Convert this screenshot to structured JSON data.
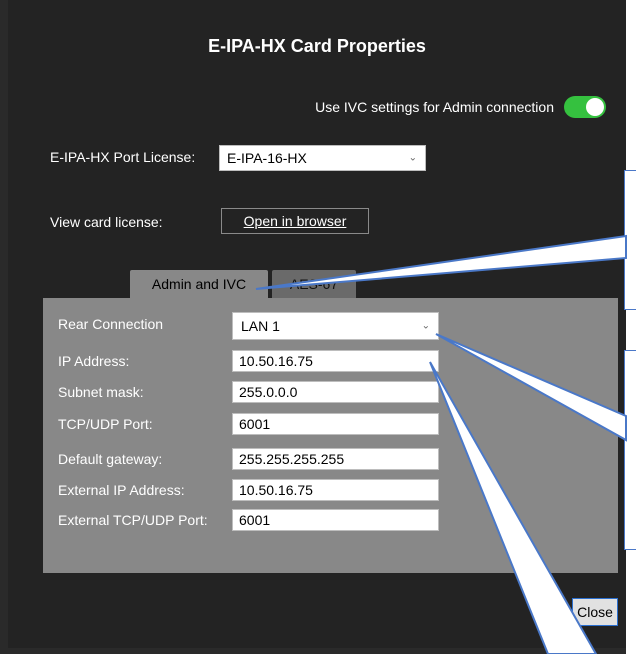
{
  "window": {
    "title": "E-IPA-HX Card Properties"
  },
  "admin_toggle": {
    "label": "Use IVC settings for Admin connection",
    "state": "on",
    "color": "#35c13f"
  },
  "port_license": {
    "label": "E-IPA-HX Port License:",
    "selected": "E-IPA-16-HX"
  },
  "card_license": {
    "label": "View card license:",
    "button_label": "Open in browser"
  },
  "tabs": [
    {
      "label": "Admin and IVC",
      "active": true
    },
    {
      "label": "AES-67",
      "active": false
    }
  ],
  "settings": {
    "rear_connection": {
      "label": "Rear Connection",
      "value": "LAN 1"
    },
    "fields": [
      {
        "label": "IP Address:",
        "value": "10.50.16.75"
      },
      {
        "label": "Subnet mask:",
        "value": "255.0.0.0"
      },
      {
        "label": "TCP/UDP Port:",
        "value": "6001"
      },
      {
        "label": "Default gateway:",
        "value": "255.255.255.255"
      },
      {
        "label": "External IP Address:",
        "value": "10.50.16.75"
      },
      {
        "label": "External TCP/UDP Port:",
        "value": "6001"
      }
    ]
  },
  "footer": {
    "close_label": "Close"
  },
  "icons": {
    "dropdown": "chevron-down-icon"
  },
  "colors": {
    "dialog_bg": "#232323",
    "panel_bg": "#888888",
    "callout_border": "#4a78c8"
  }
}
